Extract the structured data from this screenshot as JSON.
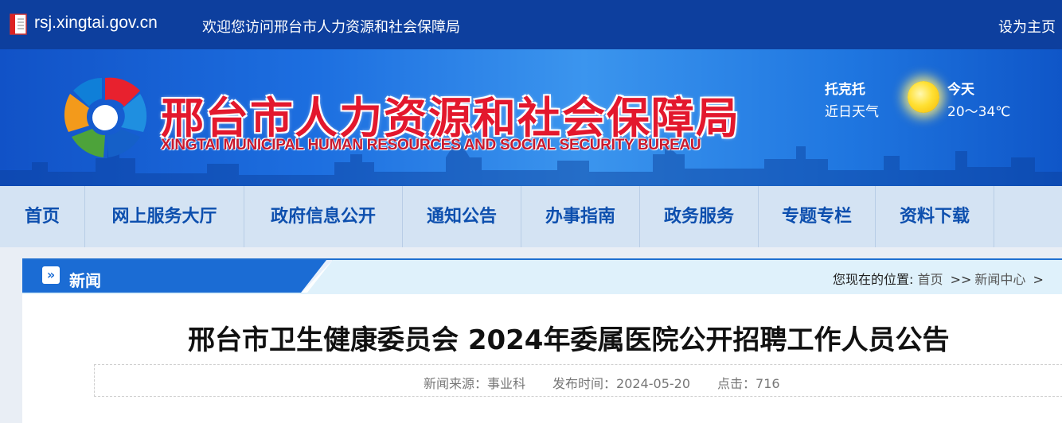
{
  "topbar": {
    "domain": "rsj.xingtai.gov.cn",
    "welcome": "欢迎您访问邢台市人力资源和社会保障局",
    "set_home": "设为主页"
  },
  "banner": {
    "title_cn": "邢台市人力资源和社会保障局",
    "title_en": "XINGTAI MUNICIPAL HUMAN RESOURCES AND SOCIAL SECURITY BUREAU",
    "weather": {
      "city": "托克托",
      "label": "近日天气",
      "day": "今天",
      "temp": "20～34℃",
      "icon": "sun-icon"
    }
  },
  "nav": {
    "items": [
      "首页",
      "网上服务大厅",
      "政府信息公开",
      "通知公告",
      "办事指南",
      "政务服务",
      "专题专栏",
      "资料下载"
    ]
  },
  "section": {
    "title": "新闻",
    "icon": "double-chevron-icon",
    "breadcrumb_prefix": "您现在的位置:",
    "breadcrumb_home": "首页",
    "breadcrumb_sep": ">>",
    "breadcrumb_current": "新闻中心",
    "breadcrumb_tail": ">"
  },
  "article": {
    "title": "邢台市卫生健康委员会 2024年委属医院公开招聘工作人员公告",
    "source": "新闻来源：事业科",
    "published": "发布时间：2024-05-20",
    "clicks": "点击：716"
  },
  "colors": {
    "topbar": "#0d3f9e",
    "nav_bg": "#d4e3f3",
    "nav_text": "#0d4fae",
    "title_red": "#e3182d",
    "section_blue": "#1b6cd4"
  }
}
